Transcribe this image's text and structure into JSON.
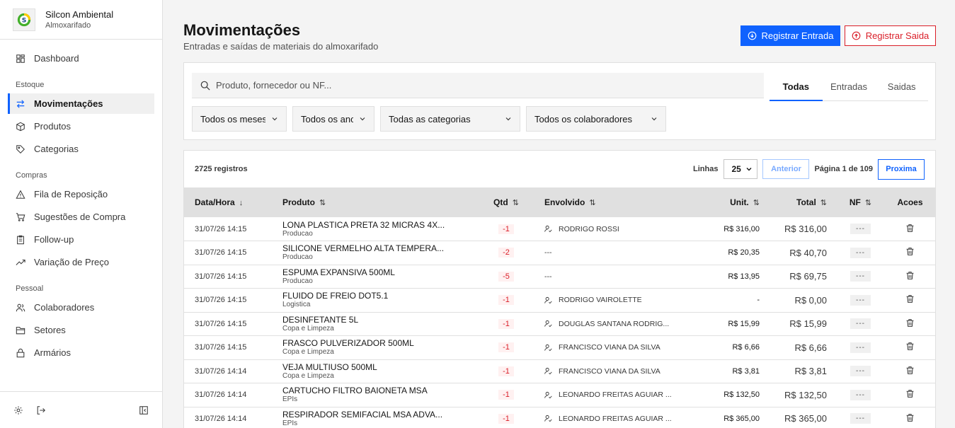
{
  "brand": {
    "name": "Silcon Ambiental",
    "sub": "Almoxarifado"
  },
  "nav": {
    "dashboard": "Dashboard",
    "sec_estoque": "Estoque",
    "movimentacoes": "Movimentações",
    "produtos": "Produtos",
    "categorias": "Categorias",
    "sec_compras": "Compras",
    "fila": "Fila de Reposição",
    "sugestoes": "Sugestões de Compra",
    "followup": "Follow-up",
    "variacao": "Variação de Preço",
    "sec_pessoal": "Pessoal",
    "colaboradores": "Colaboradores",
    "setores": "Setores",
    "armarios": "Armários"
  },
  "header": {
    "title": "Movimentações",
    "subtitle": "Entradas e saídas de materiais do almoxarifado",
    "btn_entrada": "Registrar Entrada",
    "btn_saida": "Registrar Saida"
  },
  "filters": {
    "search_placeholder": "Produto, fornecedor ou NF...",
    "tabs": [
      "Todas",
      "Entradas",
      "Saidas"
    ],
    "meses": "Todos os meses",
    "anos": "Todos os anos",
    "categorias": "Todas as categorias",
    "colaboradores": "Todos os colaboradores"
  },
  "table": {
    "count": "2725 registros",
    "linhas_label": "Linhas",
    "rows_per_page": "25",
    "prev": "Anterior",
    "page_info": "Página 1 de 109",
    "next": "Proxima",
    "columns": [
      "Data/Hora",
      "Produto",
      "Qtd",
      "Envolvido",
      "Unit.",
      "Total",
      "NF",
      "Acoes"
    ],
    "sort_icons": {
      "desc": "↓",
      "both": "⇅"
    },
    "rows": [
      {
        "date": "31/07/26 14:15",
        "product": "LONA PLASTICA PRETA 32 MICRAS 4X...",
        "category": "Producao",
        "qtd": "-1",
        "person": "RODRIGO ROSSI",
        "unit": "R$ 316,00",
        "total": "R$ 316,00",
        "nf": "---"
      },
      {
        "date": "31/07/26 14:15",
        "product": "SILICONE VERMELHO ALTA TEMPERA...",
        "category": "Producao",
        "qtd": "-2",
        "person": "---",
        "unit": "R$ 20,35",
        "total": "R$ 40,70",
        "nf": "---"
      },
      {
        "date": "31/07/26 14:15",
        "product": "ESPUMA EXPANSIVA 500ML",
        "category": "Producao",
        "qtd": "-5",
        "person": "---",
        "unit": "R$ 13,95",
        "total": "R$ 69,75",
        "nf": "---"
      },
      {
        "date": "31/07/26 14:15",
        "product": "FLUIDO DE FREIO DOT5.1",
        "category": "Logistica",
        "qtd": "-1",
        "person": "RODRIGO VAIROLETTE",
        "unit": "-",
        "total": "R$ 0,00",
        "nf": "---"
      },
      {
        "date": "31/07/26 14:15",
        "product": "DESINFETANTE 5L",
        "category": "Copa e Limpeza",
        "qtd": "-1",
        "person": "DOUGLAS SANTANA RODRIG...",
        "unit": "R$ 15,99",
        "total": "R$ 15,99",
        "nf": "---"
      },
      {
        "date": "31/07/26 14:15",
        "product": "FRASCO PULVERIZADOR 500ML",
        "category": "Copa e Limpeza",
        "qtd": "-1",
        "person": "FRANCISCO VIANA DA SILVA",
        "unit": "R$ 6,66",
        "total": "R$ 6,66",
        "nf": "---"
      },
      {
        "date": "31/07/26 14:14",
        "product": "VEJA MULTIUSO 500ML",
        "category": "Copa e Limpeza",
        "qtd": "-1",
        "person": "FRANCISCO VIANA DA SILVA",
        "unit": "R$ 3,81",
        "total": "R$ 3,81",
        "nf": "---"
      },
      {
        "date": "31/07/26 14:14",
        "product": "CARTUCHO FILTRO BAIONETA MSA",
        "category": "EPIs",
        "qtd": "-1",
        "person": "LEONARDO FREITAS AGUIAR ...",
        "unit": "R$ 132,50",
        "total": "R$ 132,50",
        "nf": "---"
      },
      {
        "date": "31/07/26 14:14",
        "product": "RESPIRADOR SEMIFACIAL MSA ADVA...",
        "category": "EPIs",
        "qtd": "-1",
        "person": "LEONARDO FREITAS AGUIAR ...",
        "unit": "R$ 365,00",
        "total": "R$ 365,00",
        "nf": "---"
      }
    ]
  },
  "icons": [
    "dashboard-icon",
    "arrows-icon",
    "box-icon",
    "tag-icon",
    "warning-icon",
    "cart-icon",
    "clipboard-icon",
    "trend-icon",
    "users-icon",
    "folder-icon",
    "lock-icon",
    "settings-icon",
    "logout-icon",
    "collapse-icon",
    "search-icon",
    "chevron-down-icon",
    "user-check-icon",
    "trash-icon"
  ],
  "colors": {
    "accent": "#0f62fe",
    "danger": "#da1e28"
  }
}
